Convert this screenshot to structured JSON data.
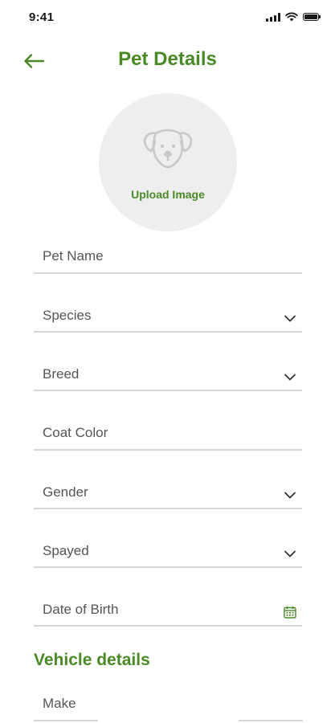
{
  "status_bar": {
    "time": "9:41",
    "icons": [
      "signal-icon",
      "wifi-icon",
      "battery-icon"
    ]
  },
  "header": {
    "title": "Pet Details",
    "back_icon": "back-arrow-icon"
  },
  "upload": {
    "label": "Upload Image",
    "icon": "dog-icon"
  },
  "fields": {
    "pet_name": {
      "placeholder": "Pet Name"
    },
    "species": {
      "label": "Species",
      "icon": "chevron-down-icon"
    },
    "breed": {
      "label": "Breed",
      "icon": "chevron-down-icon"
    },
    "coat_color": {
      "placeholder": "Coat Color"
    },
    "gender": {
      "label": "Gender",
      "icon": "chevron-down-icon"
    },
    "spayed": {
      "label": "Spayed",
      "icon": "chevron-down-icon"
    },
    "date_of_birth": {
      "label": "Date of Birth",
      "icon": "calendar-icon"
    }
  },
  "vehicle": {
    "title": "Vehicle details",
    "make": {
      "placeholder": "Make"
    },
    "second_field": {
      "placeholder": ""
    }
  },
  "colors": {
    "accent": "#4a8a26",
    "field_line": "#d6d6d6",
    "upload_bg": "#eeeeee",
    "icon_gray": "#c8c8c8"
  }
}
